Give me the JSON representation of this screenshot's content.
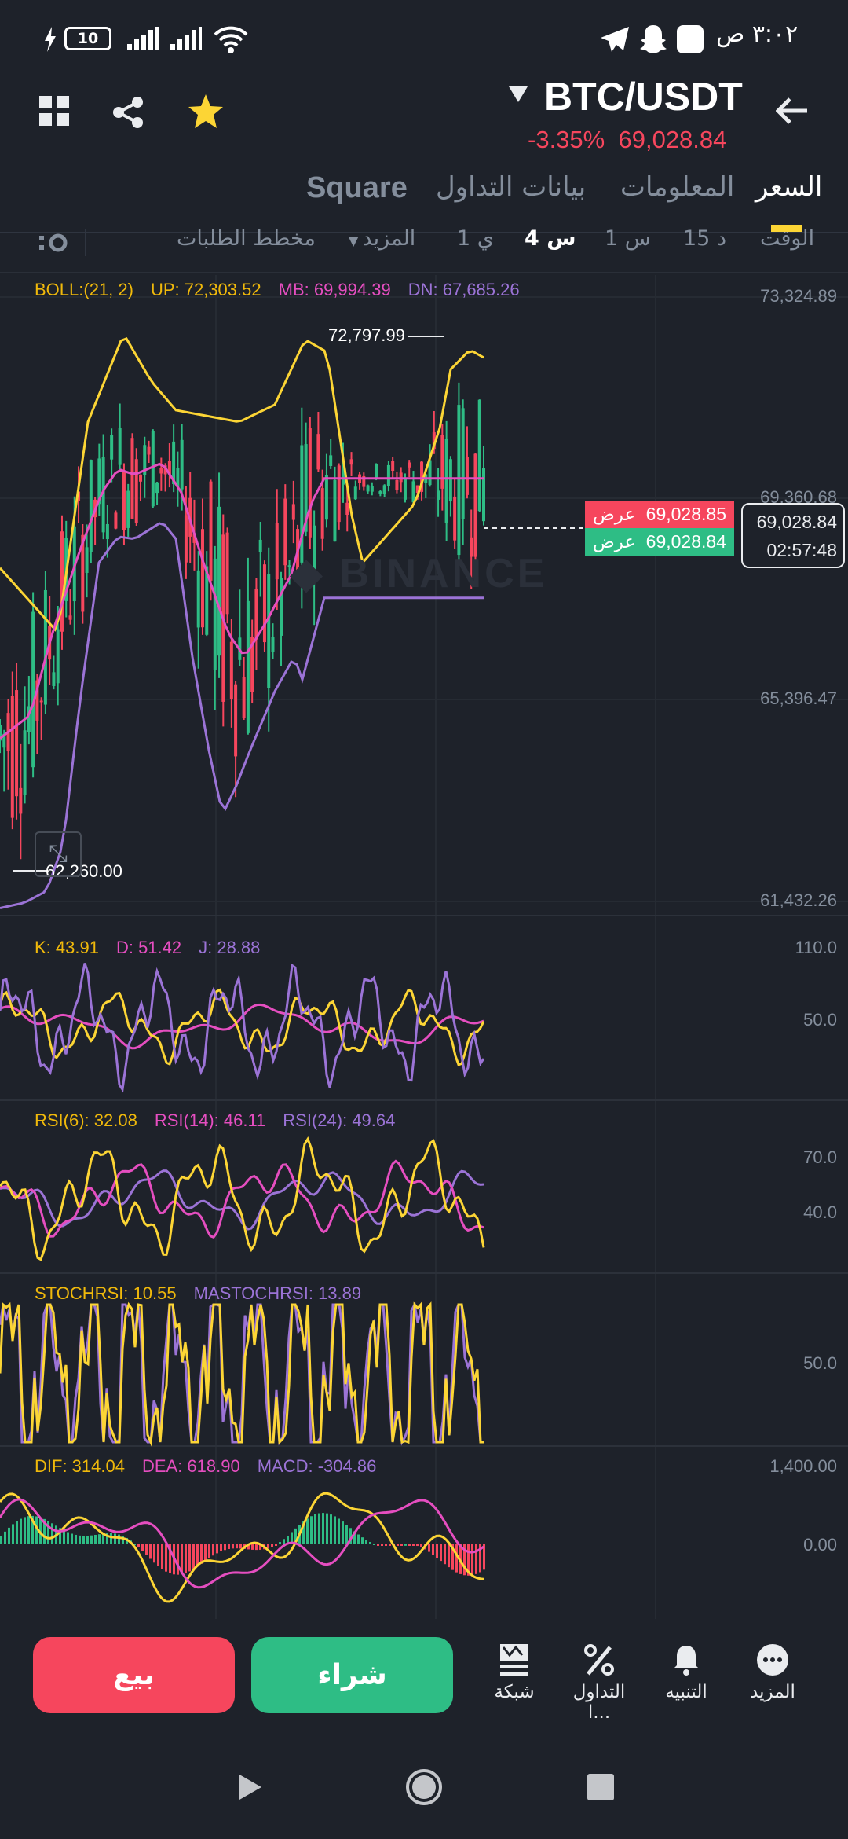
{
  "status_bar": {
    "time": "٣:٠٢ ص",
    "battery": "10"
  },
  "header": {
    "pair": "BTC/USDT",
    "change": "-3.35%",
    "price": "69,028.84"
  },
  "tabs": [
    {
      "label": "السعر",
      "active": true
    },
    {
      "label": "المعلومات"
    },
    {
      "label": "بيانات التداول"
    },
    {
      "label": "Square"
    }
  ],
  "intervals": {
    "time": "الوقت",
    "m15": "15 د",
    "h1": "1 س",
    "h4": "4 س",
    "d1": "1 ي",
    "more": "المزيد",
    "depth": "مخطط الطلبات"
  },
  "boll": {
    "label": "BOLL:(21, 2)",
    "up": "UP: 72,303.52",
    "mb": "MB: 69,994.39",
    "dn": "DN: 67,685.26"
  },
  "price_axis": [
    "73,324.89",
    "69,360.68",
    "65,396.47",
    "61,432.26"
  ],
  "markers": {
    "high": "72,797.99",
    "low": "62,260.00"
  },
  "order_tags": {
    "ask_label": "عرض",
    "ask": "69,028.85",
    "bid_label": "عرض",
    "bid": "69,028.84",
    "last": "69,028.84",
    "countdown": "02:57:48"
  },
  "watermark": "BINANCE",
  "kdj": {
    "k": "K: 43.91",
    "d": "D: 51.42",
    "j": "J: 28.88",
    "axis": [
      "110.0",
      "50.0"
    ]
  },
  "rsi": {
    "r6": "RSI(6): 32.08",
    "r14": "RSI(14): 46.11",
    "r24": "RSI(24): 49.64",
    "axis": [
      "70.0",
      "40.0"
    ]
  },
  "stochrsi": {
    "s": "STOCHRSI: 10.55",
    "ma": "MASTOCHRSI: 13.89",
    "axis": [
      "50.0"
    ]
  },
  "macd": {
    "dif": "DIF: 314.04",
    "dea": "DEA: 618.90",
    "macd": "MACD: -304.86",
    "axis": [
      "1,400.00",
      "0.00"
    ]
  },
  "actions": {
    "sell": "بيع",
    "buy": "شراء",
    "grid": "شبكة",
    "trade": "التداول ا...",
    "alert": "التنبيه",
    "more": "المزيد"
  },
  "colors": {
    "up": "#2ebd85",
    "down": "#f6465d",
    "accent": "#fcd535",
    "mb": "#e54ec0",
    "dn": "#9b73d6"
  },
  "chart_data": {
    "type": "line",
    "title": "BTC/USDT 4h",
    "ylim": [
      61432.26,
      73324.89
    ],
    "candles": 118,
    "series": [
      {
        "name": "UP",
        "x": [
          0,
          21,
          32,
          45,
          55,
          64,
          87,
          100,
          111,
          119,
          128,
          132,
          151,
          160,
          164,
          171,
          176
        ],
        "values": [
          67993,
          66725,
          70868,
          72599,
          71671,
          71099,
          70868,
          71208,
          72490,
          72243,
          69028,
          68101,
          69260,
          70744,
          71903,
          72289,
          72135
        ]
      },
      {
        "name": "MB",
        "x": [
          0,
          11,
          19,
          29,
          37,
          43,
          49,
          59,
          66,
          74,
          83,
          89,
          97,
          106,
          113,
          118
        ],
        "values": [
          64639,
          65102,
          66710,
          68333,
          69476,
          69940,
          69832,
          70064,
          69476,
          68101,
          66710,
          66246,
          66942,
          67869,
          69245,
          69755
        ]
      },
      {
        "name": "DN",
        "x": [
          0,
          9,
          17,
          23,
          29,
          36,
          43,
          49,
          59,
          64,
          70,
          76,
          81,
          86,
          91,
          100,
          107,
          110,
          118
        ],
        "values": [
          61300,
          61409,
          61640,
          62568,
          65334,
          68101,
          68611,
          68565,
          68905,
          68565,
          66246,
          64407,
          63140,
          63711,
          64407,
          65566,
          66246,
          65798,
          67405
        ]
      }
    ]
  }
}
